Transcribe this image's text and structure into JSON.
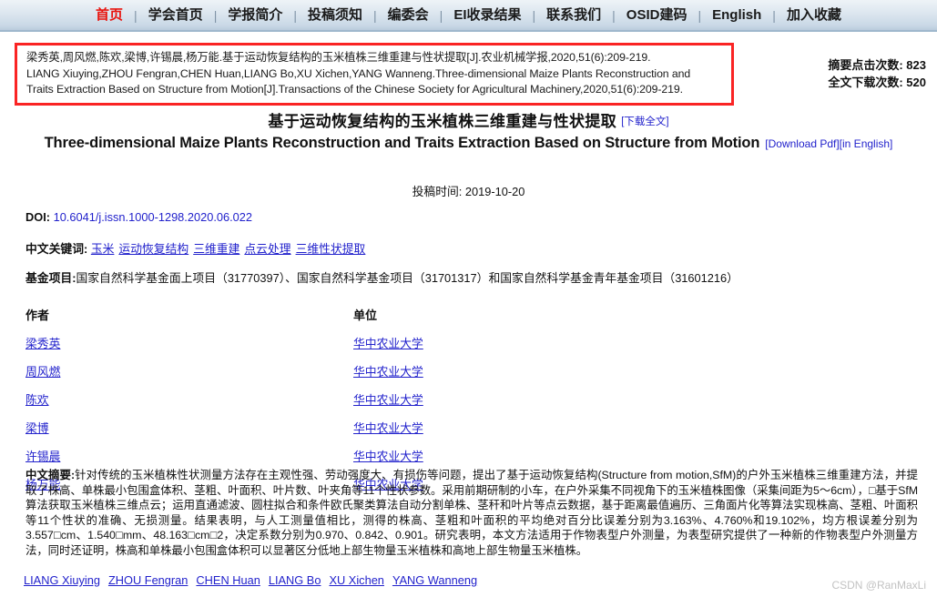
{
  "nav": {
    "separator": "|",
    "items": [
      {
        "label": "首页",
        "active": true
      },
      {
        "label": "学会首页",
        "active": false
      },
      {
        "label": "学报简介",
        "active": false
      },
      {
        "label": "投稿须知",
        "active": false
      },
      {
        "label": "编委会",
        "active": false
      },
      {
        "label": "EI收录结果",
        "active": false
      },
      {
        "label": "联系我们",
        "active": false
      },
      {
        "label": "OSID建码",
        "active": false
      },
      {
        "label": "English",
        "active": false
      },
      {
        "label": "加入收藏",
        "active": false
      }
    ]
  },
  "citation": {
    "line1": "梁秀英,周风燃,陈欢,梁博,许锡晨,杨万能.基于运动恢复结构的玉米植株三维重建与性状提取[J].农业机械学报,2020,51(6):209-219.",
    "line2": "LIANG Xiuying,ZHOU Fengran,CHEN Huan,LIANG Bo,XU Xichen,YANG Wanneng.Three-dimensional Maize Plants Reconstruction and",
    "line3": "Traits Extraction Based on Structure from Motion[J].Transactions of the Chinese Society for Agricultural Machinery,2020,51(6):209-219."
  },
  "stats": {
    "abstract_views_label": "摘要点击次数:",
    "abstract_views_value": "823",
    "fulltext_downloads_label": "全文下载次数:",
    "fulltext_downloads_value": "520"
  },
  "title": {
    "chinese": "基于运动恢复结构的玉米植株三维重建与性状提取",
    "chinese_download_link": "[下载全文]",
    "english": "Three-dimensional Maize Plants Reconstruction and Traits Extraction Based on Structure from Motion",
    "english_download_link": "[Download Pdf][in English]"
  },
  "submission": {
    "label": "投稿时间:",
    "date": "2019-10-20"
  },
  "meta": {
    "doi_label": "DOI:",
    "doi_value": "10.6041/j.issn.1000-1298.2020.06.022",
    "keywords_label": "中文关键词:",
    "keywords": [
      "玉米",
      "运动恢复结构",
      "三维重建",
      "点云处理",
      "三维性状提取"
    ],
    "fund_label": "基金项目:",
    "fund_value": "国家自然科学基金面上项目（31770397）、国家自然科学基金项目（31701317）和国家自然科学基金青年基金项目（31601216）"
  },
  "authors_table": {
    "header_author": "作者",
    "header_affiliation": "单位",
    "rows": [
      {
        "author": "梁秀英",
        "affiliation": "华中农业大学"
      },
      {
        "author": "周风燃",
        "affiliation": "华中农业大学"
      },
      {
        "author": "陈欢",
        "affiliation": "华中农业大学"
      },
      {
        "author": "梁博",
        "affiliation": "华中农业大学"
      },
      {
        "author": "许锡晨",
        "affiliation": "华中农业大学"
      },
      {
        "author": "杨万能",
        "affiliation": "华中农业大学"
      }
    ]
  },
  "abstract": {
    "label": "中文摘要:",
    "text": "针对传统的玉米植株性状测量方法存在主观性强、劳动强度大、有损伤等问题，提出了基于运动恢复结构(Structure from motion,SfM)的户外玉米植株三维重建方法，并提取了株高、单株最小包围盒体积、茎粗、叶面积、叶片数、叶夹角等11个性状参数。采用前期研制的小车，在户外采集不同视角下的玉米植株图像（采集间距为5～6cm），□基于SfM算法获取玉米植株三维点云；运用直通滤波、圆柱拟合和条件欧氏聚类算法自动分割单株、茎秆和叶片等点云数据，基于距离最值遍历、三角面片化等算法实现株高、茎粗、叶面积等11个性状的准确、无损测量。结果表明，与人工测量值相比，测得的株高、茎粗和叶面积的平均绝对百分比误差分别为3.163%、4.760%和19.102%，均方根误差分别为3.557□cm、1.540□mm、48.163□cm□2，决定系数分别为0.970、0.842、0.901。研究表明，本文方法适用于作物表型户外测量，为表型研究提供了一种新的作物表型户外测量方法，同时还证明，株高和单株最小包围盒体积可以显著区分低地上部生物量玉米植株和高地上部生物量玉米植株。"
  },
  "bottom_authors": [
    "LIANG Xiuying",
    "ZHOU Fengran",
    "CHEN Huan",
    "LIANG Bo",
    "XU Xichen",
    "YANG Wanneng"
  ],
  "watermark": "CSDN @RanMaxLi",
  "colors": {
    "nav_active": "#e8150f",
    "link": "#2222cc",
    "citation_border": "#fa2424",
    "text": "#111111",
    "watermark": "#c2c2c2"
  }
}
